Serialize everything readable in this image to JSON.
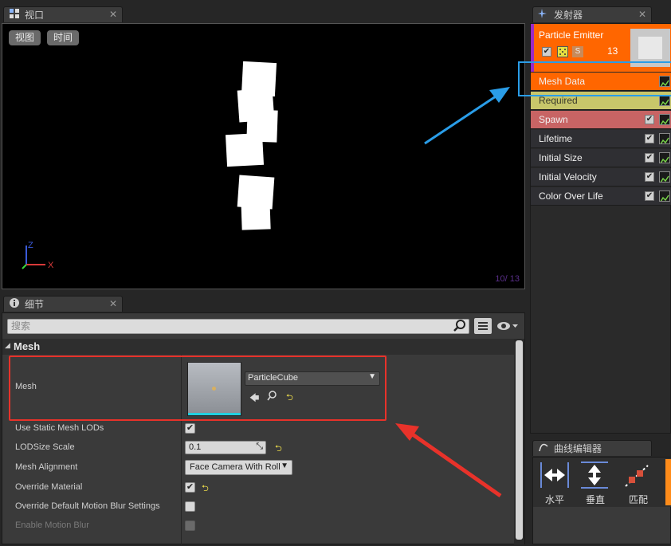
{
  "viewport": {
    "tab_label": "视口",
    "btn_view": "视图",
    "btn_time": "时间",
    "axis_z": "Z",
    "axis_x": "X",
    "counter": "10/ 13"
  },
  "details": {
    "tab_label": "细节",
    "search_placeholder": "搜索",
    "section": "Mesh",
    "mesh_label": "Mesh",
    "mesh_value": "ParticleCube",
    "use_static_lods": "Use Static Mesh LODs",
    "lodsize_label": "LODSize Scale",
    "lodsize_value": "0.1",
    "alignment_label": "Mesh Alignment",
    "alignment_value": "Face Camera With Roll",
    "override_material": "Override Material",
    "override_blur": "Override Default Motion Blur Settings",
    "enable_blur": "Enable Motion Blur"
  },
  "emitter": {
    "tab_label": "发射器",
    "name": "Particle Emitter",
    "s_badge": "S",
    "count": "13",
    "modules": [
      {
        "label": "Mesh Data",
        "color": "#ff6600"
      },
      {
        "label": "Required",
        "color": "#c8c66a"
      },
      {
        "label": "Spawn",
        "color": "#c86464"
      },
      {
        "label": "Lifetime",
        "color": "#2f2f33"
      },
      {
        "label": "Initial Size",
        "color": "#2f2f33"
      },
      {
        "label": "Initial Velocity",
        "color": "#2f2f33"
      },
      {
        "label": "Color Over Life",
        "color": "#2f2f33"
      }
    ]
  },
  "curve_editor": {
    "tab_label": "曲线编辑器",
    "horizontal": "水平",
    "vertical": "垂直",
    "fit": "匹配"
  },
  "colors": {
    "accent_orange": "#ff6600",
    "highlight_blue": "#2a9de8",
    "highlight_red": "#e8322a"
  }
}
